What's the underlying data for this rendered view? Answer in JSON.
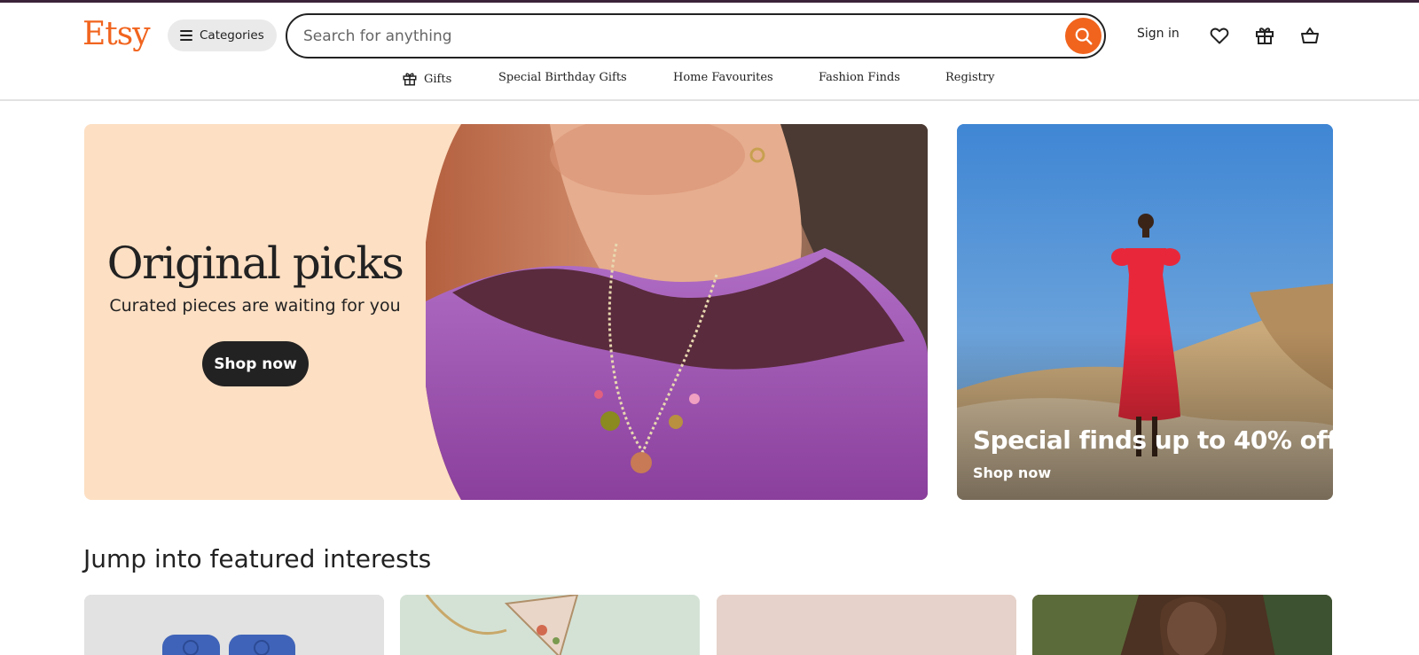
{
  "header": {
    "logo": "Etsy",
    "categories_label": "Categories",
    "search_placeholder": "Search for anything",
    "signin_label": "Sign in"
  },
  "subnav": {
    "items": [
      "Gifts",
      "Special Birthday Gifts",
      "Home Favourites",
      "Fashion Finds",
      "Registry"
    ]
  },
  "hero": {
    "title": "Original picks",
    "subtitle": "Curated pieces are waiting for you",
    "button_label": "Shop now"
  },
  "promo": {
    "title": "Special finds up to 40% off",
    "link_label": "Shop now"
  },
  "featured": {
    "title": "Jump into featured interests"
  },
  "colors": {
    "brand": "#f1641e",
    "hero_bg": "#fddfc3",
    "dark": "#222222"
  },
  "icons": [
    "menu-icon",
    "search-icon",
    "heart-icon",
    "gift-icon",
    "basket-icon"
  ]
}
